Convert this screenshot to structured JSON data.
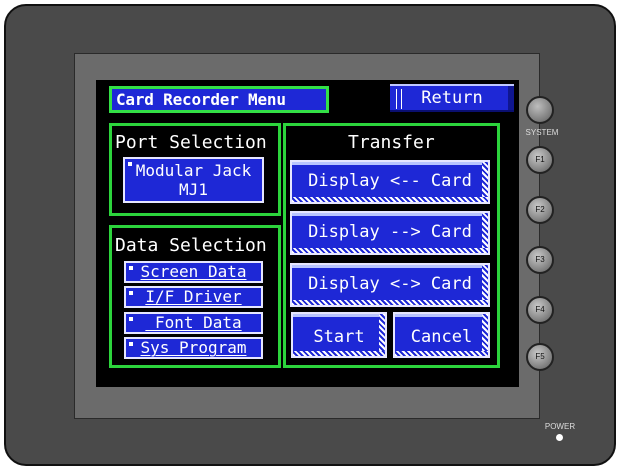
{
  "screen": {
    "title": "Card Recorder Menu",
    "return_label": "Return"
  },
  "port_selection": {
    "title": "Port Selection",
    "option_line1": "Modular Jack",
    "option_line2": "MJ1"
  },
  "data_selection": {
    "title": "Data Selection",
    "items": [
      {
        "label": "Screen Data"
      },
      {
        "label": "I/F Driver"
      },
      {
        "label": " Font Data"
      },
      {
        "label": "Sys Program"
      }
    ]
  },
  "transfer": {
    "title": "Transfer",
    "buttons": [
      {
        "label": "Display <-- Card"
      },
      {
        "label": "Display --> Card"
      },
      {
        "label": "Display <-> Card"
      }
    ],
    "start_label": "Start",
    "cancel_label": "Cancel"
  },
  "hardware": {
    "system_label": "SYSTEM",
    "function_keys": [
      "F1",
      "F2",
      "F3",
      "F4",
      "F5"
    ],
    "power_label": "POWER"
  },
  "colors": {
    "button_blue": "#1e28d6",
    "panel_green": "#2cd43c",
    "screen_bg": "#000000",
    "bezel": "#4a4a4a"
  }
}
